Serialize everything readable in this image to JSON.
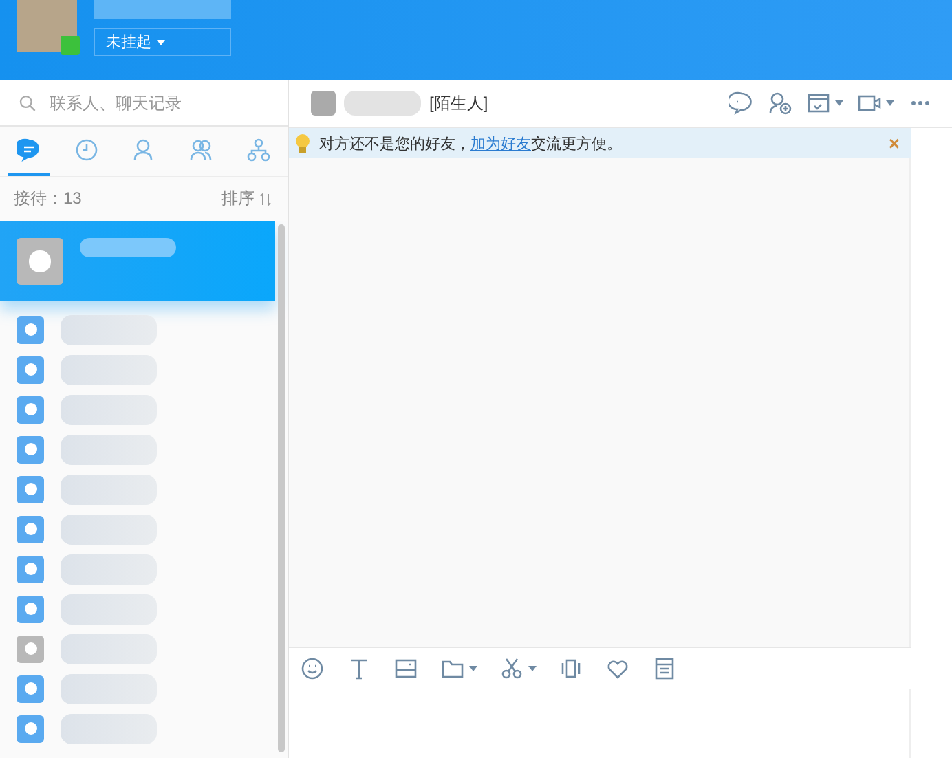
{
  "header": {
    "status": "未挂起",
    "online": true
  },
  "search": {
    "placeholder": "联系人、聊天记录"
  },
  "tabs": [
    {
      "kind": "chat",
      "selected": true
    },
    {
      "kind": "recent",
      "selected": false
    },
    {
      "kind": "contact",
      "selected": false
    },
    {
      "kind": "group",
      "selected": false
    },
    {
      "kind": "org",
      "selected": false
    }
  ],
  "counter": {
    "label": "接待：13"
  },
  "sort": {
    "label": "排序"
  },
  "contacts": [
    {
      "selected": true,
      "online": false
    },
    {
      "selected": false,
      "online": true
    },
    {
      "selected": false,
      "online": true
    },
    {
      "selected": false,
      "online": true
    },
    {
      "selected": false,
      "online": true
    },
    {
      "selected": false,
      "online": true
    },
    {
      "selected": false,
      "online": true
    },
    {
      "selected": false,
      "online": true
    },
    {
      "selected": false,
      "online": true
    },
    {
      "selected": false,
      "online": false
    },
    {
      "selected": false,
      "online": true
    },
    {
      "selected": false,
      "online": true
    }
  ],
  "chat": {
    "tag": "[陌生人]",
    "notice": {
      "before": "对方还不是您的好友，",
      "link": "加为好友",
      "after": "交流更方便。",
      "close": "×"
    },
    "header_tools": [
      {
        "kind": "chat-share"
      },
      {
        "kind": "add-person"
      },
      {
        "kind": "task",
        "dropdown": true
      },
      {
        "kind": "video",
        "dropdown": true
      },
      {
        "kind": "more"
      }
    ],
    "tools": [
      {
        "kind": "emoji"
      },
      {
        "kind": "text"
      },
      {
        "kind": "image"
      },
      {
        "kind": "folder",
        "dropdown": true
      },
      {
        "kind": "scissors",
        "dropdown": true
      },
      {
        "kind": "vibrate"
      },
      {
        "kind": "heart"
      },
      {
        "kind": "calendar"
      }
    ]
  }
}
